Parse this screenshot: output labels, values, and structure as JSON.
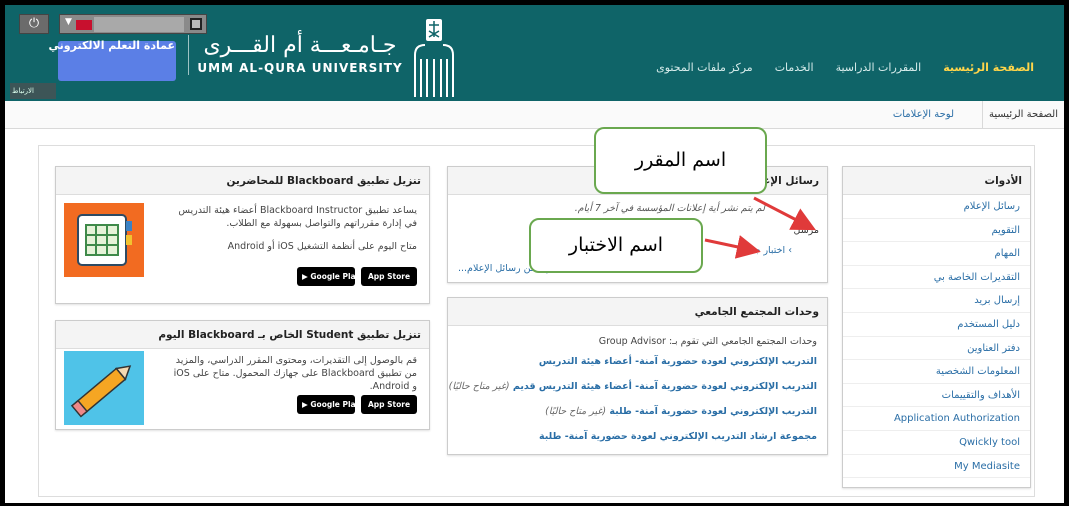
{
  "header": {
    "power_icon": "power-icon",
    "user_name": "عمادة التعلم الالكتروني",
    "connection_label": "الارتباط",
    "logo_arabic": "جـامـعـــة أم القـــرى",
    "logo_english": "UMM AL-QURA UNIVERSITY",
    "nav": [
      {
        "label": "الصفحة الرئيسية",
        "active": true
      },
      {
        "label": "المقررات الدراسية",
        "active": false
      },
      {
        "label": "الخدمات",
        "active": false
      },
      {
        "label": "مركز ملفات المحتوى",
        "active": false
      }
    ],
    "brand_color": "#0f6468"
  },
  "breadcrumb": {
    "home": "الصفحة الرئيسية",
    "current": "لوحة الإعلامات"
  },
  "tools": {
    "title": "الأدوات",
    "items": [
      "رسائل الإعلام",
      "التقويم",
      "المهام",
      "التقديرات الخاصة بي",
      "إرسال بريد",
      "دليل المستخدم",
      "دفتر العناوين",
      "المعلومات الشخصية",
      "الأهداف والتقييمات",
      "Application Authorization",
      "Qwickly tool",
      "My Mediasite"
    ]
  },
  "announcements": {
    "title": "رسائل الإعلام",
    "empty_text": "لم يتم نشر أية إعلانات المؤسسة في آخر 7 أيام.",
    "sender": "مرسل",
    "new_test": "› اختبار جديد",
    "more_link": "مزيد من رسائل الإعلام..."
  },
  "community": {
    "title": "وحدات المجتمع الجامعي",
    "intro": "وحدات المجتمع الجامعي التي تقوم بـ: Group Advisor",
    "groups": [
      {
        "label": "التدريب الإلكتروني لعودة حضورية آمنة- أعضاء هيئة التدريس",
        "note": ""
      },
      {
        "label": "التدريب الإلكتروني لعودة حضورية آمنة- أعضاء هيئة التدريس قديم",
        "note": "(غير متاح حاليًا)"
      },
      {
        "label": "التدريب الإلكتروني لعودة حضورية آمنة- طلبة",
        "note": "(غير متاح حاليًا)"
      },
      {
        "label": "مجموعة ارشاد التدريب الإلكتروني لعودة حضورية آمنة- طلبة",
        "note": ""
      }
    ]
  },
  "app_instructor": {
    "title": "تنزيل تطبيق Blackboard للمحاضرين",
    "desc": "يساعد تطبيق Blackboard Instructor أعضاء هيئة التدريس في إدارة مقرراتهم والتواصل بسهولة مع الطلاب.",
    "availability": "متاح اليوم على أنظمة التشغيل iOS أو Android",
    "google_play": "Google Play",
    "app_store": "App Store"
  },
  "app_student": {
    "title": "تنزيل تطبيق Student الخاص بـ Blackboard اليوم",
    "desc": "قم بالوصول إلى التقديرات، ومحتوى المقرر الدراسي، والمزيد من تطبيق Blackboard على جهازك المحمول. متاح على iOS و Android.",
    "google_play": "Google Play",
    "app_store": "App Store"
  },
  "callouts": {
    "course_name": "اسم المقرر",
    "test_name": "اسم الاختبار",
    "color": "#6aa84f",
    "arrow_color": "#e03a3a"
  }
}
